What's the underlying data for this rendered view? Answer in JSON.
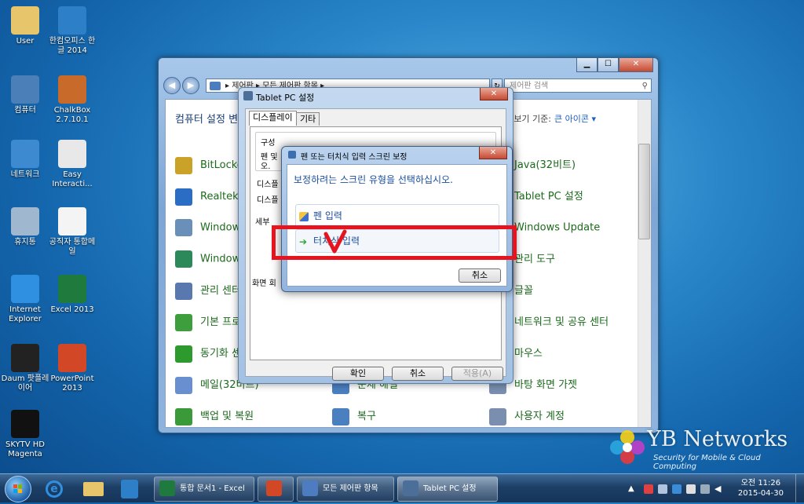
{
  "desktop": {
    "icons": [
      {
        "label": "User",
        "color": "#e7c56b"
      },
      {
        "label": "한컴오피스 한글 2014",
        "color": "#2d7fc8"
      },
      {
        "label": "컴퓨터",
        "color": "#4a7fb8"
      },
      {
        "label": "ChalkBox 2.7.10.1",
        "color": "#c86a2a"
      },
      {
        "label": "네트워크",
        "color": "#3d8ad0"
      },
      {
        "label": "Easy Interacti...",
        "color": "#e8e8e8"
      },
      {
        "label": "휴지통",
        "color": "#9fb7cf"
      },
      {
        "label": "공직자 통합메일",
        "color": "#f4f4f4"
      },
      {
        "label": "Internet Explorer",
        "color": "#2f8fe0"
      },
      {
        "label": "Excel 2013",
        "color": "#1f7a3e"
      },
      {
        "label": "Daum 팟플레이어",
        "color": "#222222"
      },
      {
        "label": "PowerPoint 2013",
        "color": "#d24726"
      },
      {
        "label": "SKYTV HD Magenta",
        "color": "#111111"
      }
    ]
  },
  "control_panel": {
    "address_path": "▸ 제어판 ▸ 모든 제어판 항목 ▸",
    "search_placeholder": "제어판 검색",
    "title": "컴퓨터 설정 변",
    "view_by_label": "보기 기준:",
    "view_by_value": "큰 아이콘 ▾",
    "items_left": [
      "BitLocke 화",
      "Realtek 자",
      "Window",
      "Window",
      "관리 센터",
      "기본 프로",
      "동기화 센",
      "메일(32비트)",
      "백업 및 복원"
    ],
    "items_mid": [
      "문제 해결",
      "복구"
    ],
    "items_right": [
      "Java(32비트)",
      "Tablet PC 설정",
      "Windows Update",
      "관리 도구",
      "글꼴",
      "네트워크 및 공유 센터",
      "마우스",
      "바탕 화면 가젯",
      "사용자 계정"
    ]
  },
  "tablet_settings": {
    "title": "Tablet PC 설정",
    "tabs": [
      "디스플레이",
      "기타"
    ],
    "group_config": "구성",
    "pen_text": "펜 및",
    "pen_text2": "오.",
    "display_label": "디스플",
    "display_label2": "디스플",
    "detail_label": "세부",
    "screen_label": "화면 회",
    "ok": "확인",
    "cancel": "취소",
    "apply": "적용(A)"
  },
  "calibrate": {
    "title": "펜 또는 터치식 입력 스크린 보정",
    "prompt": "보정하려는 스크린 유형을 선택하십시오.",
    "option_pen": "펜 입력",
    "option_touch": "터치식 입력",
    "cancel": "취소",
    "close": "✕"
  },
  "taskbar": {
    "buttons": [
      "통합 문서1 - Excel",
      "",
      "모든 제어판 항목",
      "Tablet PC 설정"
    ],
    "time": "오전 11:26",
    "date": "2015-04-30"
  },
  "watermark": {
    "name": "YB Networks",
    "tagline": "Security for Mobile & Cloud Computing"
  }
}
